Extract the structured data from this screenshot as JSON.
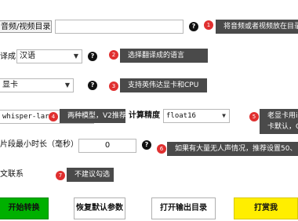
{
  "source": {
    "button_label": "音频/视频目录",
    "tip": "将音频或者视频放在目录",
    "num": "1"
  },
  "translate": {
    "label": "译成",
    "selected": "汉语",
    "tip": "选择翻译成的语言",
    "num": "2"
  },
  "device": {
    "selected": "显卡",
    "tip": "支持英伟达显卡和CPU",
    "num": "3"
  },
  "model": {
    "selected": "whisper-lar",
    "tip": "两种模型，V2推荐",
    "num": "4",
    "precision_label": "计算精度",
    "precision_selected": "float16",
    "precision_tip_line1": "老显卡用int",
    "precision_tip_line2": "卡默认，C",
    "precision_num": "5"
  },
  "segment": {
    "label": "片段最小时长（毫秒）",
    "value": "0",
    "tip": "如果有大量无人声情况，推荐设置50、",
    "num": "6"
  },
  "context": {
    "label": "文联系",
    "tip": "不建议勾选",
    "num": "7"
  },
  "help_glyph": "?",
  "caret_glyph": "▼",
  "buttons": {
    "start": "开始转换",
    "reset": "恢复默认参数",
    "open_output": "打开输出目录",
    "donate": "打赏我"
  },
  "colors": {
    "start_bg": "#00b000",
    "donate_bg": "#ffee00",
    "tip_bg": "#4a4a4a",
    "badge_red": "#e03030"
  }
}
